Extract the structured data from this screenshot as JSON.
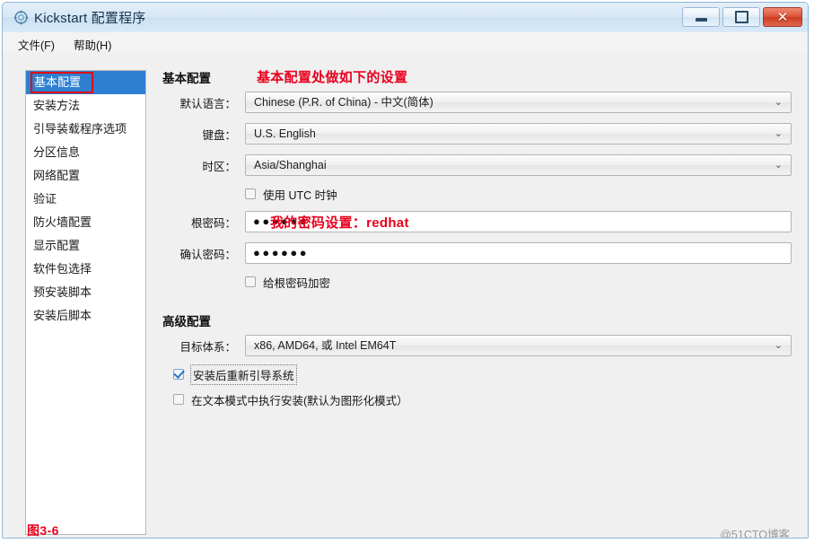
{
  "window": {
    "title": "Kickstart 配置程序",
    "icon": "gear-icon",
    "controls": {
      "minimize": "最小化",
      "maximize": "最大化",
      "close": "✕"
    }
  },
  "menubar": {
    "items": [
      {
        "label": "文件(F)",
        "name": "menu-file"
      },
      {
        "label": "帮助(H)",
        "name": "menu-help"
      }
    ]
  },
  "sidebar": {
    "selected_index": 0,
    "items": [
      {
        "label": "基本配置"
      },
      {
        "label": "安装方法"
      },
      {
        "label": "引导装载程序选项"
      },
      {
        "label": "分区信息"
      },
      {
        "label": "网络配置"
      },
      {
        "label": "验证"
      },
      {
        "label": "防火墙配置"
      },
      {
        "label": "显示配置"
      },
      {
        "label": "软件包选择"
      },
      {
        "label": "预安装脚本"
      },
      {
        "label": "安装后脚本"
      }
    ]
  },
  "main": {
    "basic_section_title": "基本配置",
    "advanced_section_title": "高级配置",
    "fields": {
      "language_label": "默认语言：",
      "language_value": "Chinese (P.R. of China) - 中文(简体)",
      "keyboard_label": "键盘：",
      "keyboard_value": "U.S. English",
      "timezone_label": "时区：",
      "timezone_value": "Asia/Shanghai",
      "utc_checkbox_label": "使用 UTC 时钟",
      "utc_checked": false,
      "root_password_label": "根密码：",
      "root_password_value": "●●●●●●",
      "confirm_password_label": "确认密码：",
      "confirm_password_value": "●●●●●●",
      "encrypt_checkbox_label": "给根密码加密",
      "encrypt_checked": false,
      "target_arch_label": "目标体系：",
      "target_arch_value": "x86, AMD64, 或 Intel EM64T",
      "reboot_checkbox_label": "安装后重新引导系统",
      "reboot_checked": true,
      "text_mode_checkbox_label": "在文本模式中执行安装(默认为图形化模式）",
      "text_mode_checked": false
    }
  },
  "annotations": {
    "basic_note": "基本配置处做如下的设置",
    "password_note": "我的密码设置：redhat",
    "figure_caption": "图3-6",
    "accent_color": "#e8001d"
  },
  "watermark": {
    "text": "@51CTO博客"
  },
  "icons": {
    "chevron_down": "⌄"
  }
}
